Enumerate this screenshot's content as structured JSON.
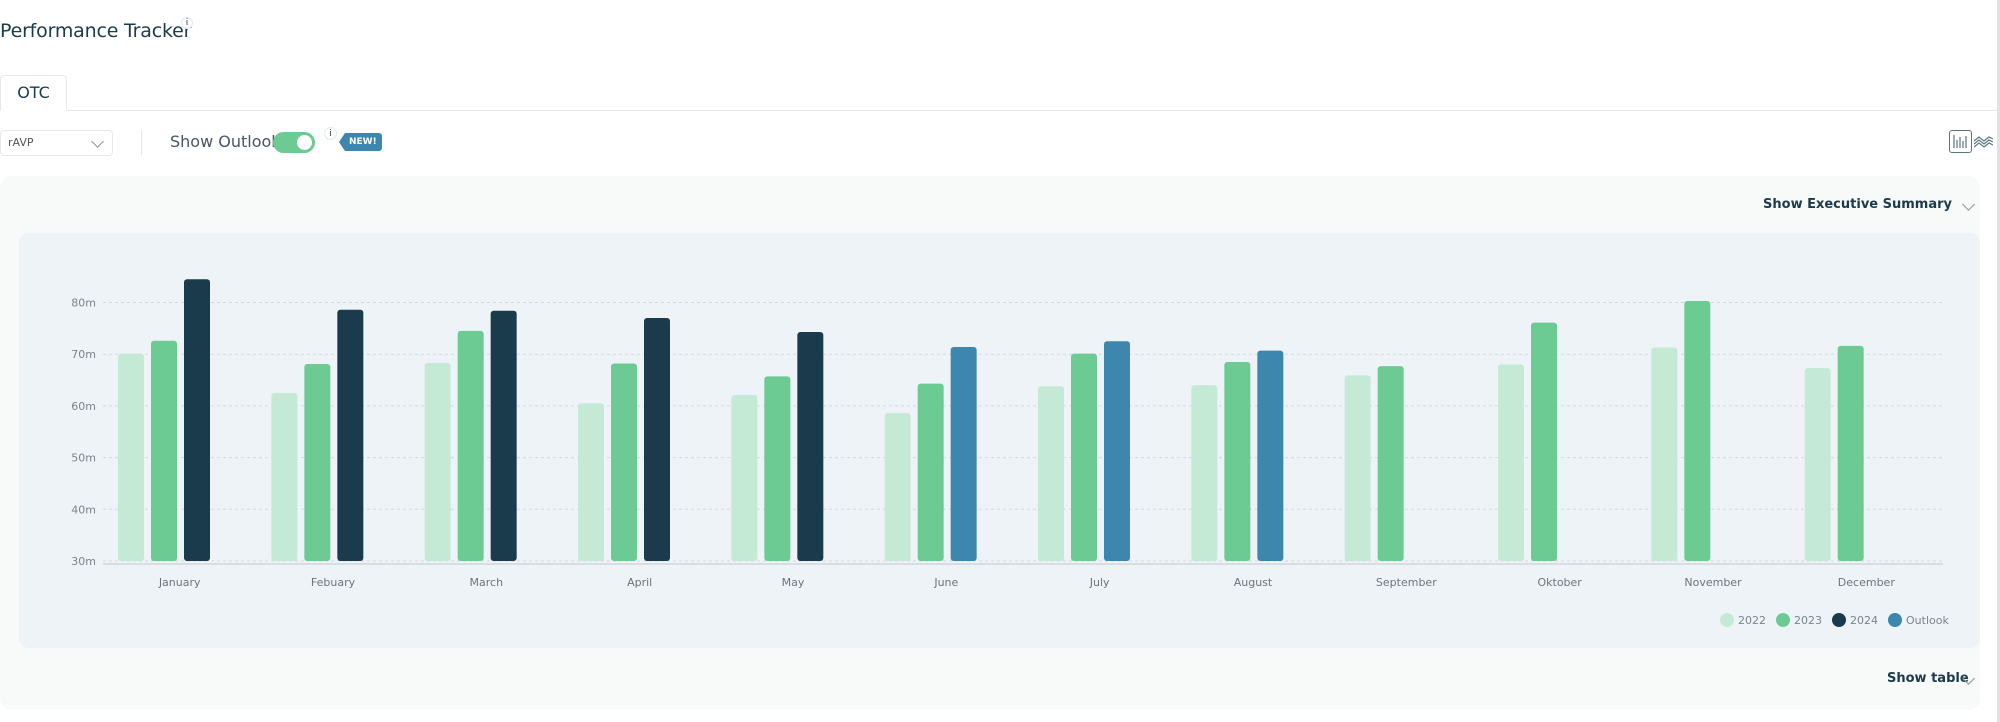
{
  "header": {
    "title": "Performance Tracker",
    "info_glyph": "i"
  },
  "tabs": [
    {
      "label": "OTC",
      "active": true
    }
  ],
  "controls": {
    "metric_select": {
      "value": "rAVP"
    },
    "outlook_toggle": {
      "label": "Show Outlook",
      "on": true,
      "info_glyph": "i"
    },
    "new_badge": "NEW!",
    "chart_type_icons": [
      "bar-chart-icon",
      "line-chart-icon"
    ]
  },
  "panel": {
    "exec_summary_label": "Show Executive Summary",
    "show_table_label": "Show table"
  },
  "colors": {
    "2022": "#c4e9d5",
    "2023": "#6ccb93",
    "2024": "#1a3b4c",
    "Outlook": "#3d87ae"
  },
  "chart_data": {
    "type": "bar",
    "title": "",
    "xlabel": "",
    "ylabel": "",
    "ylim": [
      30,
      85
    ],
    "yticks": [
      30,
      40,
      50,
      60,
      70,
      80
    ],
    "ytick_labels": [
      "30m",
      "40m",
      "50m",
      "60m",
      "70m",
      "80m"
    ],
    "grid": true,
    "legend_position": "bottom-right",
    "categories": [
      "January",
      "Febuary",
      "March",
      "April",
      "May",
      "June",
      "July",
      "August",
      "September",
      "Oktober",
      "November",
      "December"
    ],
    "series": [
      {
        "name": "2022",
        "values": [
          70.1,
          62.5,
          68.3,
          60.5,
          62.1,
          58.6,
          63.8,
          64.0,
          65.9,
          68.0,
          71.3,
          67.3
        ]
      },
      {
        "name": "2023",
        "values": [
          72.6,
          68.1,
          74.5,
          68.2,
          65.7,
          64.3,
          70.1,
          68.5,
          67.7,
          76.1,
          80.3,
          71.6
        ]
      },
      {
        "name": "2024",
        "values": [
          84.5,
          78.6,
          78.4,
          77.0,
          74.3,
          null,
          null,
          null,
          null,
          null,
          null,
          null
        ]
      },
      {
        "name": "Outlook",
        "values": [
          null,
          null,
          null,
          null,
          null,
          71.4,
          72.5,
          70.7,
          null,
          null,
          null,
          null
        ]
      }
    ]
  }
}
